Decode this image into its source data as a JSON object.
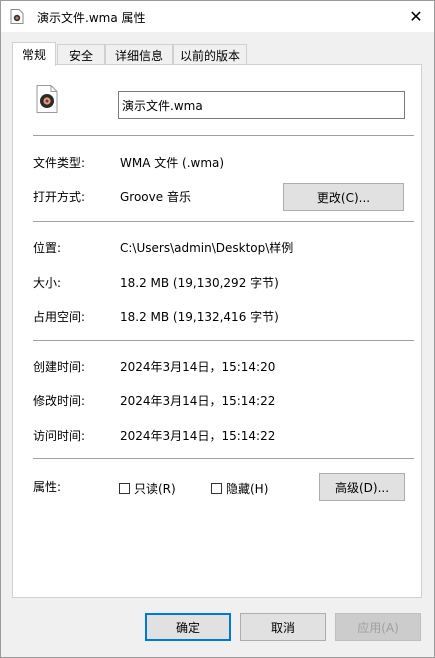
{
  "window": {
    "title": "演示文件.wma 属性",
    "close_glyph": "✕"
  },
  "tabs": [
    {
      "label": "常规",
      "active": true
    },
    {
      "label": "安全",
      "active": false
    },
    {
      "label": "详细信息",
      "active": false
    },
    {
      "label": "以前的版本",
      "active": false
    }
  ],
  "general": {
    "file_name": "演示文件.wma",
    "type_label": "文件类型:",
    "type_value": "WMA 文件 (.wma)",
    "opens_label": "打开方式:",
    "opens_value": "Groove 音乐",
    "change_button": "更改(C)...",
    "location_label": "位置:",
    "location_value": "C:\\Users\\admin\\Desktop\\样例",
    "size_label": "大小:",
    "size_value": "18.2 MB (19,130,292 字节)",
    "disk_label": "占用空间:",
    "disk_value": "18.2 MB (19,132,416 字节)",
    "created_label": "创建时间:",
    "created_value": "2024年3月14日，15:14:20",
    "modified_label": "修改时间:",
    "modified_value": "2024年3月14日，15:14:22",
    "accessed_label": "访问时间:",
    "accessed_value": "2024年3月14日，15:14:22",
    "attributes_label": "属性:",
    "readonly_label": "只读(R)",
    "hidden_label": "隐藏(H)",
    "advanced_button": "高级(D)..."
  },
  "footer": {
    "ok": "确定",
    "cancel": "取消",
    "apply": "应用(A)"
  },
  "colors": {
    "accent": "#0078d7",
    "disc_ring": "#e8a06a",
    "disc_center": "#6b2c8a"
  }
}
